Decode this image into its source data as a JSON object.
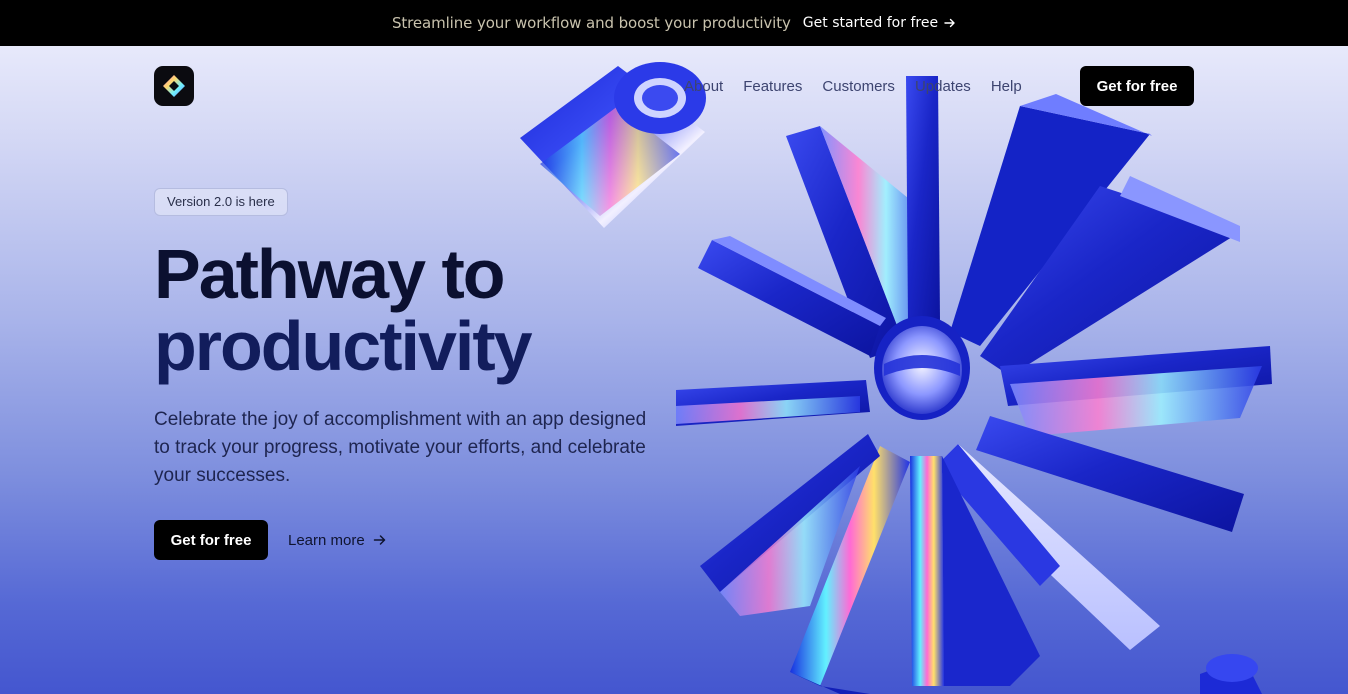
{
  "announcement": {
    "text": "Streamline your workflow and boost your productivity",
    "cta_label": "Get started for free",
    "arrow_icon": "arrow-right-icon"
  },
  "nav": {
    "logo_icon": "diamond-logo-icon",
    "links": [
      "About",
      "Features",
      "Customers",
      "Updates",
      "Help"
    ],
    "cta_label": "Get for free"
  },
  "hero": {
    "badge": "Version 2.0 is here",
    "headline_line1": "Pathway to",
    "headline_line2": "productivity",
    "subtext": "Celebrate the joy of accomplishment with an app designed to track your progress, motivate your efforts, and celebrate your successes.",
    "primary_cta": "Get for free",
    "secondary_cta": "Learn more",
    "secondary_icon": "arrow-right-icon"
  },
  "colors": {
    "brand_black": "#000000",
    "accent_blue": "#2430d8",
    "background_top": "#e7e9fb",
    "background_bottom": "#4456cf"
  }
}
